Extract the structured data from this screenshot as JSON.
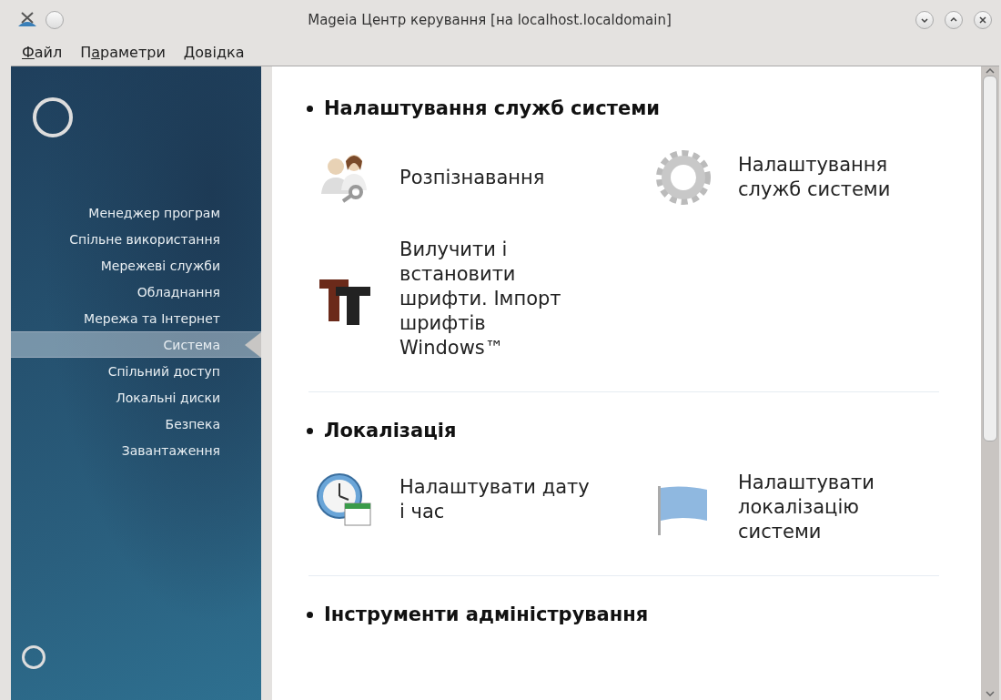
{
  "window": {
    "title": "Mageia Центр керування  [на localhost.localdomain]"
  },
  "menu": [
    {
      "key": "Ф",
      "after": "айл"
    },
    {
      "before": "П",
      "key": "а",
      "after": "раметри"
    },
    {
      "key": "Д",
      "after": "овідка"
    }
  ],
  "sidebar": {
    "items": [
      {
        "label": "Менеджер програм",
        "selected": false
      },
      {
        "label": "Спільне використання",
        "selected": false
      },
      {
        "label": "Мережеві служби",
        "selected": false
      },
      {
        "label": "Обладнання",
        "selected": false
      },
      {
        "label": "Мережа та Інтернет",
        "selected": false
      },
      {
        "label": "Система",
        "selected": true
      },
      {
        "label": "Спільний доступ",
        "selected": false
      },
      {
        "label": "Локальні диски",
        "selected": false
      },
      {
        "label": "Безпека",
        "selected": false
      },
      {
        "label": "Завантаження",
        "selected": false
      }
    ]
  },
  "sections": [
    {
      "title": "Налаштування служб системи",
      "items": [
        {
          "kind": "users",
          "label": "Розпізнавання"
        },
        {
          "kind": "gear",
          "label": "Налаштування служб системи"
        },
        {
          "kind": "font",
          "label": "Вилучити і встановити шрифти. Імпорт шрифтів Windows™"
        }
      ]
    },
    {
      "title": "Локалізація",
      "items": [
        {
          "kind": "clock",
          "label": "Налаштувати дату і час"
        },
        {
          "kind": "flag",
          "label": "Налаштувати локалізацію системи"
        }
      ]
    },
    {
      "title": "Інструменти адміністрування"
    }
  ]
}
